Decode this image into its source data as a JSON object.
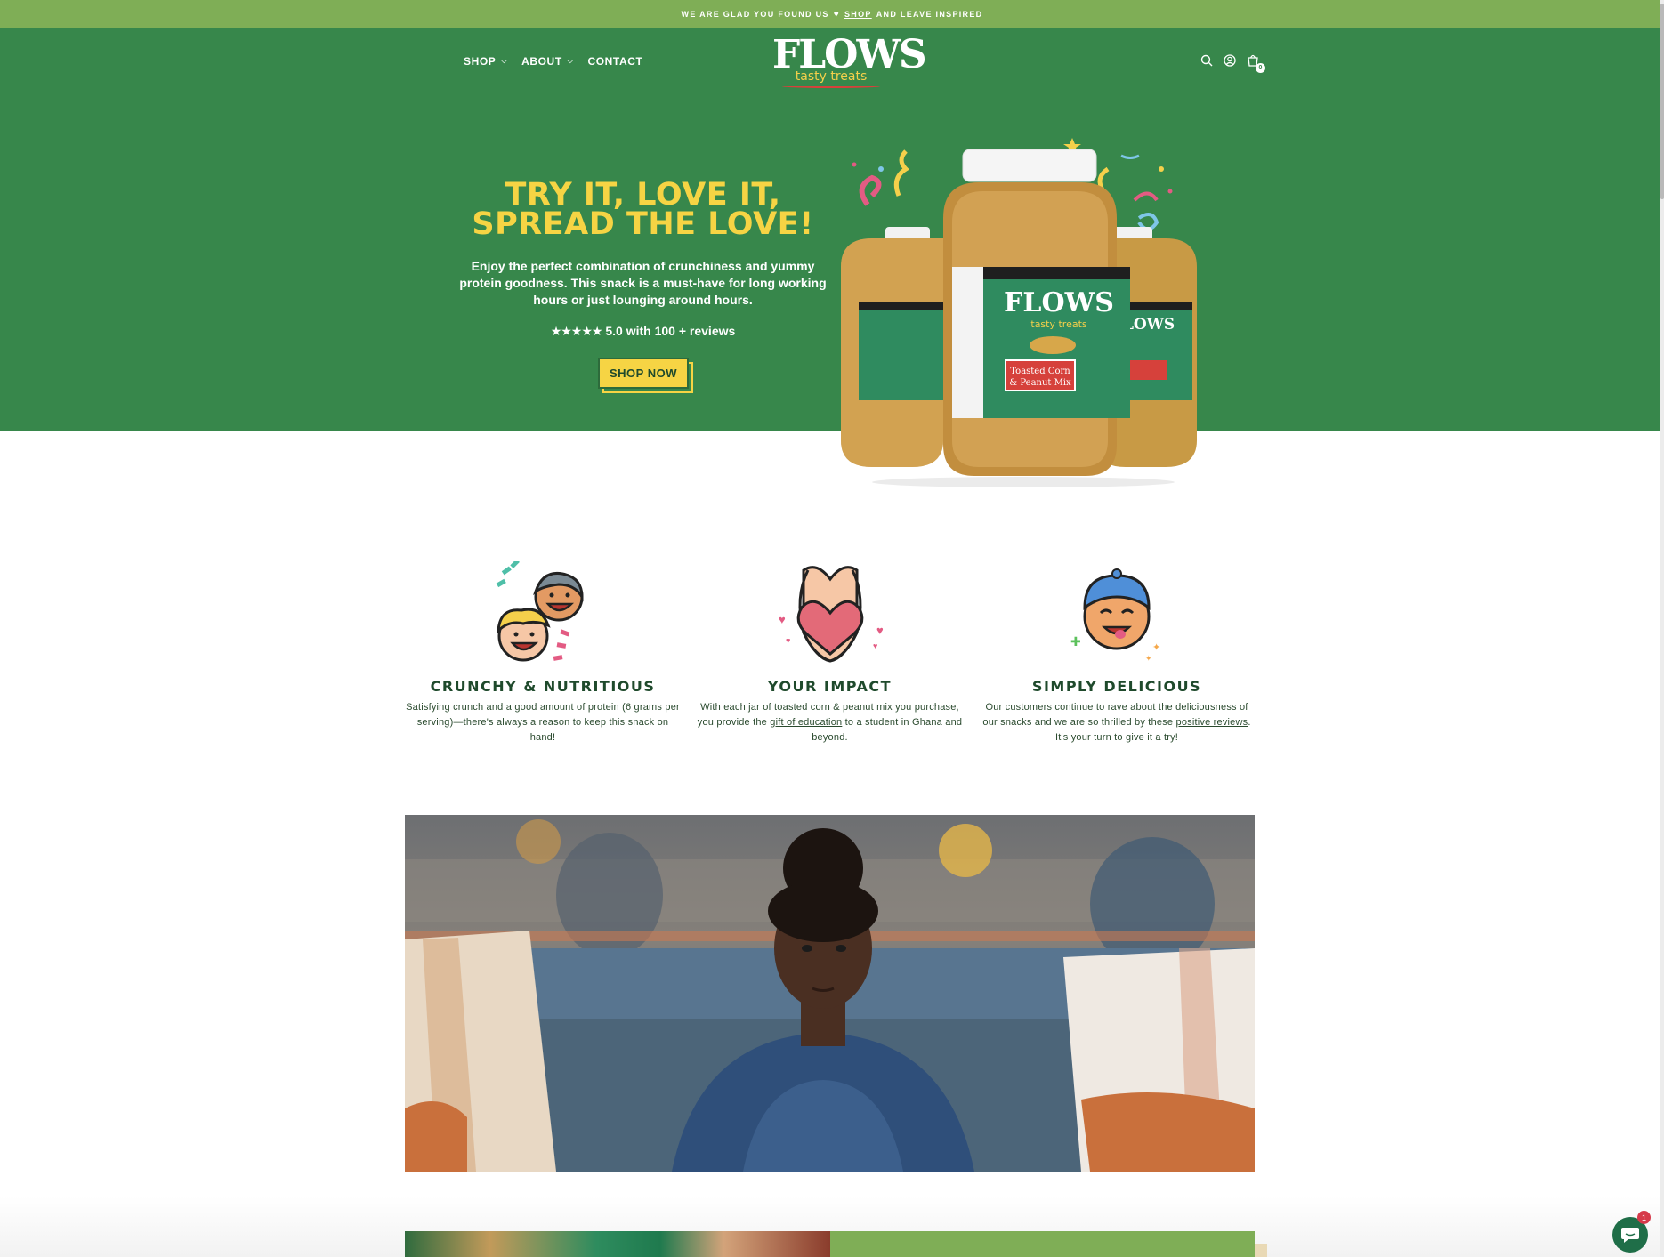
{
  "announcement": {
    "before": "WE ARE GLAD YOU FOUND US",
    "heart": "♥",
    "link": "SHOP",
    "after": "AND LEAVE INSPIRED"
  },
  "nav": {
    "items": [
      {
        "label": "SHOP",
        "has_dropdown": true
      },
      {
        "label": "ABOUT",
        "has_dropdown": true
      },
      {
        "label": "CONTACT",
        "has_dropdown": false
      }
    ]
  },
  "logo": {
    "wordmark": "FLOWS",
    "tagline": "tasty treats"
  },
  "header_icons": [
    "search-icon",
    "account-icon",
    "cart-icon"
  ],
  "cart": {
    "count": "0"
  },
  "hero": {
    "title_line1": "TRY IT, LOVE IT,",
    "title_line2": "SPREAD THE LOVE!",
    "description": "Enjoy the perfect combination of crunchiness and yummy protein goodness. This snack is a must-have for long working hours or just lounging around hours.",
    "stars": "★★★★★",
    "rating_text": "5.0 with 100 + reviews",
    "cta": "SHOP NOW",
    "product_label_brand": "FLOWS",
    "product_label_tagline": "tasty treats",
    "product_label_name_1": "Toasted Corn",
    "product_label_name_2": "& Peanut Mix"
  },
  "features": [
    {
      "icon": "happy-kids-icon",
      "title": "CRUNCHY & NUTRITIOUS",
      "text": "Satisfying crunch and a good amount of protein (6 grams per serving)—there's always a reason to keep this snack on hand!"
    },
    {
      "icon": "heart-hands-icon",
      "title": "YOUR IMPACT",
      "text_before": "With each jar of toasted corn & peanut mix you purchase, you provide the",
      "link": "gift of education",
      "text_after": "to a student in Ghana and beyond."
    },
    {
      "icon": "yummy-face-icon",
      "title": "SIMPLY DELICIOUS",
      "text_before": "Our customers continue to rave about the deliciousness of our snacks and we are so thrilled by these",
      "link": "positive reviews",
      "text_after": ". It's your turn to give it a try!"
    }
  ],
  "chat": {
    "badge": "1"
  },
  "colors": {
    "announce_bg": "#7fae56",
    "hero_bg": "#37874b",
    "accent_yellow": "#f6d444",
    "heading_dark": "#1f4a2c"
  }
}
